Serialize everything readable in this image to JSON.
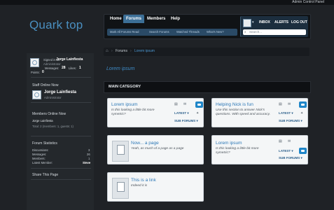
{
  "header": {
    "admin_link": "Admin Control Panel",
    "logo_text": "Quark top"
  },
  "nav": {
    "tabs": [
      {
        "label": "Home"
      },
      {
        "label": "Forums"
      },
      {
        "label": "Members"
      },
      {
        "label": "Help"
      }
    ],
    "sublinks": [
      {
        "label": "Mark All Forums Read"
      },
      {
        "label": "Search Forums"
      },
      {
        "label": "Watched Threads"
      },
      {
        "label": "What's New?"
      }
    ],
    "user_links": [
      {
        "label": "INBOX"
      },
      {
        "label": "ALERTS"
      },
      {
        "label": "LOG OUT"
      }
    ],
    "search_placeholder": "Search..."
  },
  "breadcrumb": {
    "items": [
      {
        "label": "Forums"
      },
      {
        "label": "Lorem ipsum"
      }
    ]
  },
  "page_title": "Lorem ipsum",
  "category_title": "MAIN CATEGORY",
  "sidebar": {
    "signed_in_as": "Signed in as",
    "username": "Jorge Lainfiesta",
    "role": "Administrator",
    "messages_label": "Messages:",
    "messages_value": "28",
    "likes_label": "Likes:",
    "likes_value": "1",
    "points_label": "Points:",
    "points_value": "0",
    "staff_title": "Staff Online Now",
    "staff_name": "Jorge Lainfiesta",
    "staff_role": "Administrator",
    "members_title": "Members Online Now",
    "members_name": "Jorge Lainfiesta",
    "members_total": "Total: 2 (members: 1, guests: 1)",
    "stats_title": "Forum Statistics",
    "stats": [
      {
        "label": "Discussions:",
        "value": "3"
      },
      {
        "label": "Messages:",
        "value": "26"
      },
      {
        "label": "Members:",
        "value": "1"
      },
      {
        "label": "Latest Member:",
        "value": "Steve"
      }
    ],
    "share_title": "Share This Page"
  },
  "nodes": [
    {
      "title": "Lorem ipsum",
      "desc": "Is this looking a little bit more symetric?",
      "latest": "LATEST ▾",
      "subforums": "SUB FORUMS ▾"
    },
    {
      "title": "Helping Nick is fun",
      "desc": "Use this section to answer Nick's questions. With speed and accuracy.",
      "latest": "LATEST ▾",
      "subforums": "SUB FORUMS ▾"
    },
    {
      "title": "Now... a page",
      "desc": "Yeah, as much of a page as a page"
    },
    {
      "title": "Lorem ipsum",
      "desc": "Is this looking a little bit more symetric?",
      "latest": "LATEST ▾",
      "subforums": "SUB FORUMS ▾"
    },
    {
      "title": "This is a link",
      "desc": "Indeed it is"
    }
  ]
}
